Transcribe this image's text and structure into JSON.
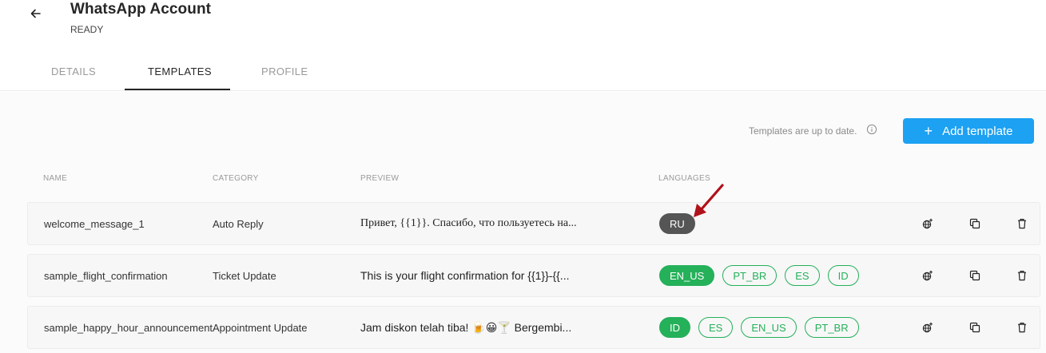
{
  "header": {
    "title": "WhatsApp Account",
    "status": "READY"
  },
  "tabs": [
    {
      "label": "DETAILS",
      "active": false
    },
    {
      "label": "TEMPLATES",
      "active": true
    },
    {
      "label": "PROFILE",
      "active": false
    }
  ],
  "toolbar": {
    "status_text": "Templates are up to date.",
    "add_button_label": "Add template"
  },
  "table": {
    "columns": [
      "NAME",
      "CATEGORY",
      "PREVIEW",
      "LANGUAGES"
    ],
    "rows": [
      {
        "name": "welcome_message_1",
        "category": "Auto Reply",
        "preview": "Привет, {{1}}. Спасибо, что пользуетесь на...",
        "languages": [
          {
            "code": "RU",
            "style": "dark"
          }
        ]
      },
      {
        "name": "sample_flight_confirmation",
        "category": "Ticket Update",
        "preview": "This is your flight confirmation for {{1}}-{{...",
        "languages": [
          {
            "code": "EN_US",
            "style": "filled"
          },
          {
            "code": "PT_BR",
            "style": "outline"
          },
          {
            "code": "ES",
            "style": "outline"
          },
          {
            "code": "ID",
            "style": "outline"
          }
        ]
      },
      {
        "name": "sample_happy_hour_announcement",
        "category": "Appointment Update",
        "preview": "Jam diskon telah tiba! 🍺😀🍸 Bergembi...",
        "languages": [
          {
            "code": "ID",
            "style": "filled"
          },
          {
            "code": "ES",
            "style": "outline"
          },
          {
            "code": "EN_US",
            "style": "outline"
          },
          {
            "code": "PT_BR",
            "style": "outline"
          }
        ]
      }
    ]
  },
  "colors": {
    "accent": "#1da1f2",
    "green": "#25b05a",
    "dark_pill": "#555555",
    "annotation_arrow": "#b0121b"
  },
  "icons": [
    "back-arrow-icon",
    "info-icon",
    "plus-icon",
    "globe-add-icon",
    "copy-icon",
    "trash-icon"
  ]
}
